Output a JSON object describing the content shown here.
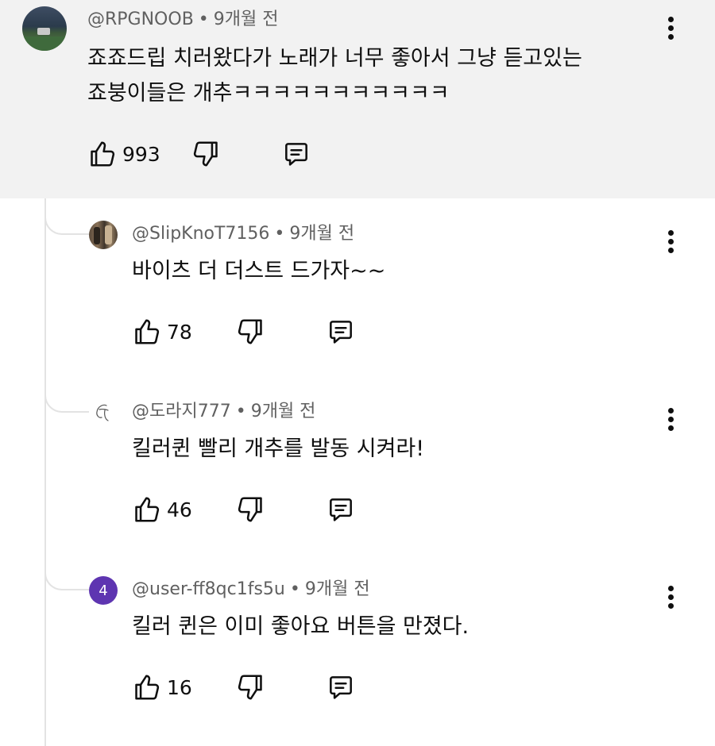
{
  "comments": [
    {
      "author": "@RPGNOOB",
      "time": "9개월 전",
      "text_line1": "죠죠드립 치러왔다가 노래가 너무 좋아서 그냥 듣고있는",
      "text_line2": "죠붕이들은 개추ㅋㅋㅋㅋㅋㅋㅋㅋㅋㅋㅋ",
      "likes": "993"
    }
  ],
  "replies": [
    {
      "author": "@SlipKnoT7156",
      "time": "9개월 전",
      "text": "바이츠 더 더스트 드가자~~",
      "likes": "78"
    },
    {
      "author": "@도라지777",
      "time": "9개월 전",
      "text": "킬러퀸 빨리 개추를 발동 시켜라!",
      "likes": "46"
    },
    {
      "author": "@user-ff8qc1fs5u",
      "time": "9개월 전",
      "text": "킬러 퀸은 이미 좋아요 버튼을 만졌다.",
      "likes": "16",
      "avatar_letter": "4"
    }
  ],
  "separator": "•",
  "icons": {
    "like": "thumb-up-icon",
    "dislike": "thumb-down-icon",
    "reply": "comment-icon",
    "menu": "more-vert-icon"
  },
  "colors": {
    "parent_bg": "#f2f2f2",
    "meta_text": "#606060",
    "avatar_user": "#5e35b1"
  }
}
